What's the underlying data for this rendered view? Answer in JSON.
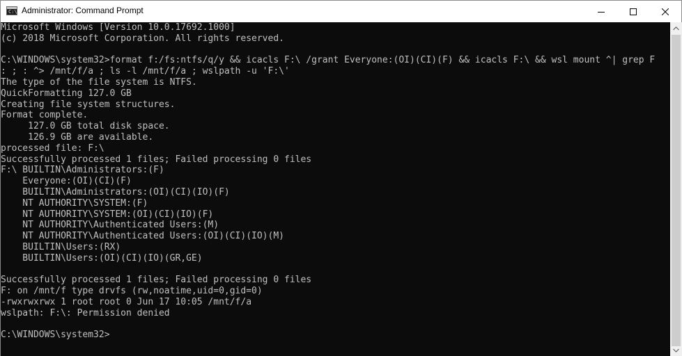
{
  "window": {
    "title": "Administrator: Command Prompt",
    "icon": "cmd-icon",
    "controls": [
      "minimize-icon",
      "maximize-icon",
      "close-icon"
    ]
  },
  "console": {
    "lines": [
      "Microsoft Windows [Version 10.0.17692.1000]",
      "(c) 2018 Microsoft Corporation. All rights reserved.",
      "",
      "C:\\WINDOWS\\system32>format f:/fs:ntfs/q/y && icacls F:\\ /grant Everyone:(OI)(CI)(F) && icacls F:\\ && wsl mount ^| grep F",
      ": ; : ^> /mnt/f/a ; ls -l /mnt/f/a ; wslpath -u 'F:\\'",
      "The type of the file system is NTFS.",
      "QuickFormatting 127.0 GB",
      "Creating file system structures.",
      "Format complete.",
      "     127.0 GB total disk space.",
      "     126.9 GB are available.",
      "processed file: F:\\",
      "Successfully processed 1 files; Failed processing 0 files",
      "F:\\ BUILTIN\\Administrators:(F)",
      "    Everyone:(OI)(CI)(F)",
      "    BUILTIN\\Administrators:(OI)(CI)(IO)(F)",
      "    NT AUTHORITY\\SYSTEM:(F)",
      "    NT AUTHORITY\\SYSTEM:(OI)(CI)(IO)(F)",
      "    NT AUTHORITY\\Authenticated Users:(M)",
      "    NT AUTHORITY\\Authenticated Users:(OI)(CI)(IO)(M)",
      "    BUILTIN\\Users:(RX)",
      "    BUILTIN\\Users:(OI)(CI)(IO)(GR,GE)",
      "",
      "Successfully processed 1 files; Failed processing 0 files",
      "F: on /mnt/f type drvfs (rw,noatime,uid=0,gid=0)",
      "-rwxrwxrwx 1 root root 0 Jun 17 10:05 /mnt/f/a",
      "wslpath: F:\\: Permission denied",
      "",
      "C:\\WINDOWS\\system32>"
    ]
  },
  "scrollbar": {
    "up_icon": "scroll-up-arrow-icon",
    "down_icon": "scroll-down-arrow-icon"
  }
}
